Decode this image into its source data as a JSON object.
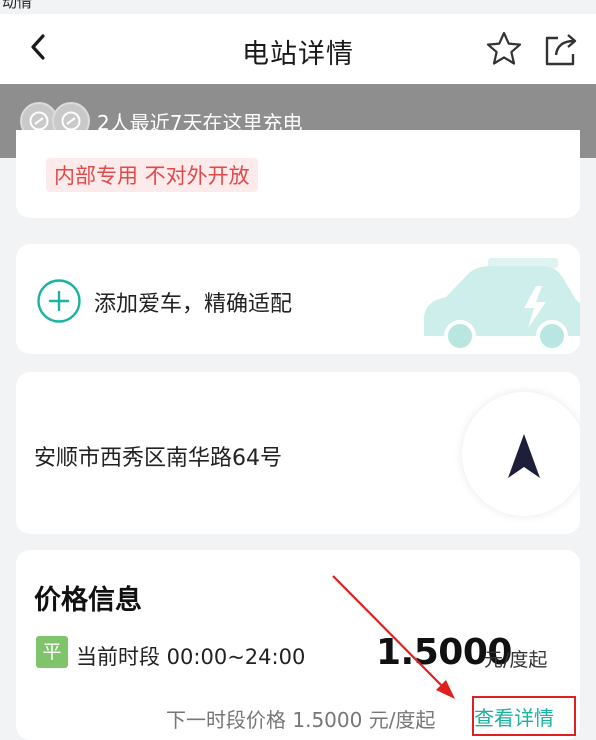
{
  "status_bar": {
    "text": "动情"
  },
  "navbar": {
    "title": "电站详情",
    "back_icon": "back-chevron-icon",
    "star_icon": "star-outline-icon",
    "share_icon": "share-icon"
  },
  "banner": {
    "text": "2人最近7天在这里充电"
  },
  "station": {
    "tag": "内部专用 不对外开放"
  },
  "add_car": {
    "text": "添加爱车，精确适配"
  },
  "location": {
    "address": "安顺市西秀区南华路64号"
  },
  "price_info": {
    "title": "价格信息",
    "badge": "平",
    "period": "当前时段 00:00~24:00",
    "price": "1.5000",
    "unit": "元/度起",
    "next_period": "下一时段价格 1.5000 元/度起",
    "detail_link": "查看详情"
  },
  "colors": {
    "accent": "#19b3a0",
    "tag_red": "#e24a4a",
    "badge_green": "#7fc36b",
    "banner_gray": "#8e8e8e",
    "annotation_red": "#e02020"
  }
}
